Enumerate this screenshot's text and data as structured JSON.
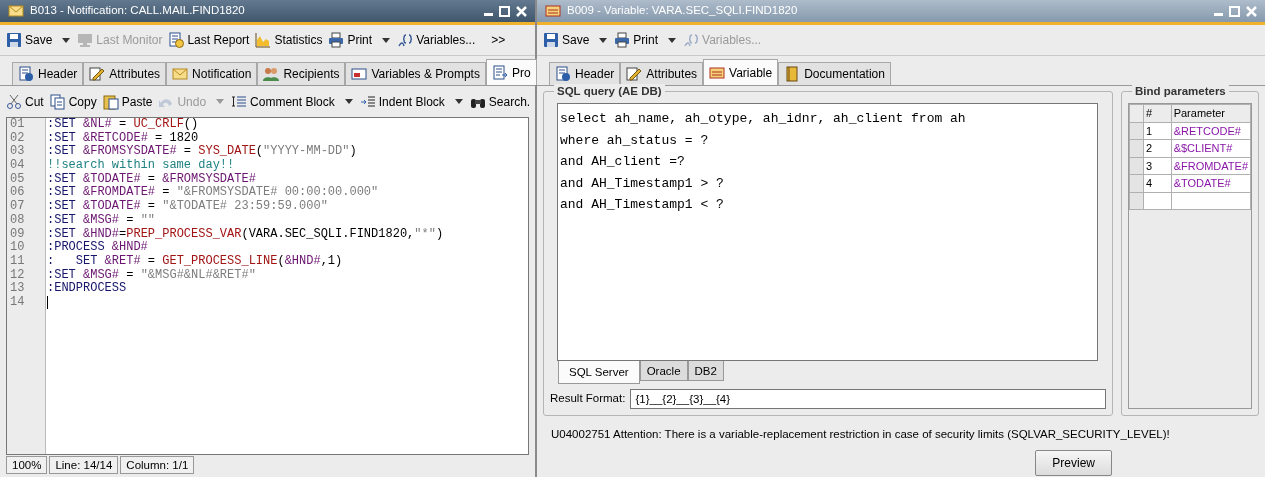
{
  "left_window": {
    "title": "B013 - Notification: CALL.MAIL.FIND1820",
    "toolbar": [
      {
        "label": "Save",
        "disabled": false,
        "dropdown": true
      },
      {
        "label": "Last Monitor",
        "disabled": true,
        "dropdown": false
      },
      {
        "label": "Last Report",
        "disabled": false,
        "dropdown": false
      },
      {
        "label": "Statistics",
        "disabled": false,
        "dropdown": false
      },
      {
        "label": "Print",
        "disabled": false,
        "dropdown": true
      },
      {
        "label": "Variables...",
        "disabled": false,
        "dropdown": false
      }
    ],
    "toolbar_overflow": ">>",
    "tabs": [
      {
        "label": "Header",
        "selected": false
      },
      {
        "label": "Attributes",
        "selected": false
      },
      {
        "label": "Notification",
        "selected": false
      },
      {
        "label": "Recipients",
        "selected": false
      },
      {
        "label": "Variables & Prompts",
        "selected": false
      },
      {
        "label": "Pro",
        "selected": true
      }
    ],
    "edit_toolbar": [
      {
        "label": "Cut",
        "disabled": false,
        "dropdown": false
      },
      {
        "label": "Copy",
        "disabled": false,
        "dropdown": false
      },
      {
        "label": "Paste",
        "disabled": false,
        "dropdown": false
      },
      {
        "label": "Undo",
        "disabled": true,
        "dropdown": true
      },
      {
        "label": "Comment Block",
        "disabled": false,
        "dropdown": true
      },
      {
        "label": "Indent Block",
        "disabled": false,
        "dropdown": true
      },
      {
        "label": "Search.",
        "disabled": false,
        "dropdown": false
      }
    ],
    "editor": {
      "lines": [
        {
          "number": "01",
          "tokens": [
            {
              "kind": "keyword",
              "text": ":SET "
            },
            {
              "kind": "variable",
              "text": "&NL#"
            },
            {
              "kind": "plain",
              "text": " = "
            },
            {
              "kind": "function",
              "text": "UC_CRLF"
            },
            {
              "kind": "plain",
              "text": "()"
            }
          ]
        },
        {
          "number": "02",
          "tokens": [
            {
              "kind": "keyword",
              "text": ":SET "
            },
            {
              "kind": "variable",
              "text": "&RETCODE#"
            },
            {
              "kind": "plain",
              "text": " = 1820"
            }
          ]
        },
        {
          "number": "03",
          "tokens": [
            {
              "kind": "keyword",
              "text": ":SET "
            },
            {
              "kind": "variable",
              "text": "&FROMSYSDATE#"
            },
            {
              "kind": "plain",
              "text": " = "
            },
            {
              "kind": "function",
              "text": "SYS_DATE"
            },
            {
              "kind": "plain",
              "text": "("
            },
            {
              "kind": "string",
              "text": "\"YYYY-MM-DD\""
            },
            {
              "kind": "plain",
              "text": ")"
            }
          ]
        },
        {
          "number": "04",
          "tokens": [
            {
              "kind": "comment",
              "text": "!!search within same day!!"
            }
          ]
        },
        {
          "number": "05",
          "tokens": [
            {
              "kind": "keyword",
              "text": ":SET "
            },
            {
              "kind": "variable",
              "text": "&TODATE#"
            },
            {
              "kind": "plain",
              "text": " = "
            },
            {
              "kind": "variable",
              "text": "&FROMSYSDATE#"
            }
          ]
        },
        {
          "number": "06",
          "tokens": [
            {
              "kind": "keyword",
              "text": ":SET "
            },
            {
              "kind": "variable",
              "text": "&FROMDATE#"
            },
            {
              "kind": "plain",
              "text": " = "
            },
            {
              "kind": "string",
              "text": "\"&FROMSYSDATE# 00:00:00.000\""
            }
          ]
        },
        {
          "number": "07",
          "tokens": [
            {
              "kind": "keyword",
              "text": ":SET "
            },
            {
              "kind": "variable",
              "text": "&TODATE#"
            },
            {
              "kind": "plain",
              "text": " = "
            },
            {
              "kind": "string",
              "text": "\"&TODATE# 23:59:59.000\""
            }
          ]
        },
        {
          "number": "08",
          "tokens": [
            {
              "kind": "keyword",
              "text": ":SET "
            },
            {
              "kind": "variable",
              "text": "&MSG#"
            },
            {
              "kind": "plain",
              "text": " = "
            },
            {
              "kind": "string",
              "text": "\"\""
            }
          ]
        },
        {
          "number": "09",
          "tokens": [
            {
              "kind": "keyword",
              "text": ":SET "
            },
            {
              "kind": "variable",
              "text": "&HND#"
            },
            {
              "kind": "plain",
              "text": "="
            },
            {
              "kind": "function",
              "text": "PREP_PROCESS_VAR"
            },
            {
              "kind": "plain",
              "text": "(VARA.SEC_SQLI.FIND1820,"
            },
            {
              "kind": "string",
              "text": "\"*\""
            },
            {
              "kind": "plain",
              "text": ")"
            }
          ]
        },
        {
          "number": "10",
          "tokens": [
            {
              "kind": "keyword",
              "text": ":PROCESS "
            },
            {
              "kind": "variable",
              "text": "&HND#"
            }
          ]
        },
        {
          "number": "11",
          "tokens": [
            {
              "kind": "keyword",
              "text": ":   SET "
            },
            {
              "kind": "variable",
              "text": "&RET#"
            },
            {
              "kind": "plain",
              "text": " = "
            },
            {
              "kind": "function",
              "text": "GET_PROCESS_LINE"
            },
            {
              "kind": "plain",
              "text": "("
            },
            {
              "kind": "variable",
              "text": "&HND#"
            },
            {
              "kind": "plain",
              "text": ",1)"
            }
          ]
        },
        {
          "number": "12",
          "tokens": [
            {
              "kind": "keyword",
              "text": ":SET "
            },
            {
              "kind": "variable",
              "text": "&MSG#"
            },
            {
              "kind": "plain",
              "text": " = "
            },
            {
              "kind": "string",
              "text": "\"&MSG#&NL#&RET#\""
            }
          ]
        },
        {
          "number": "13",
          "tokens": [
            {
              "kind": "keyword",
              "text": ":ENDPROCESS"
            }
          ]
        },
        {
          "number": "14"
        }
      ]
    },
    "status_bar": [
      "100%",
      "Line: 14/14",
      "Column: 1/1"
    ]
  },
  "right_window": {
    "title": "B009 - Variable: VARA.SEC_SQLI.FIND1820",
    "toolbar": [
      {
        "label": "Save",
        "disabled": false,
        "dropdown": true
      },
      {
        "label": "Print",
        "disabled": false,
        "dropdown": true
      },
      {
        "label": "Variables...",
        "disabled": true,
        "dropdown": false
      }
    ],
    "tabs": [
      {
        "label": "Header",
        "selected": false
      },
      {
        "label": "Attributes",
        "selected": false
      },
      {
        "label": "Variable",
        "selected": true
      },
      {
        "label": "Documentation",
        "selected": false
      }
    ],
    "sql_query": {
      "legend": "SQL query (AE DB)",
      "lines": [
        "select ah_name, ah_otype, ah_idnr, ah_client from ah",
        "where ah_status = ?",
        "and AH_client =?",
        "and AH_Timestamp1 > ?",
        "and AH_Timestamp1 < ?"
      ],
      "tabs": [
        {
          "label": "SQL Server",
          "selected": true
        },
        {
          "label": "Oracle",
          "selected": false
        },
        {
          "label": "DB2",
          "selected": false
        }
      ],
      "result_format": {
        "label": "Result Format:",
        "value": "{1}__{2}__{3}__{4}"
      }
    },
    "bind_parameters": {
      "legend": "Bind parameters",
      "columns": [
        "#",
        "Parameter"
      ],
      "rows": [
        {
          "number": "1",
          "parameter": "&RETCODE#"
        },
        {
          "number": "2",
          "parameter": "&$CLIENT#"
        },
        {
          "number": "3",
          "parameter": "&FROMDATE#"
        },
        {
          "number": "4",
          "parameter": "&TODATE#"
        }
      ]
    },
    "message": "U04002751 Attention: There is a variable-replacement restriction in case of security limits (SQLVAR_SECURITY_LEVEL)!",
    "preview_button": "Preview"
  }
}
